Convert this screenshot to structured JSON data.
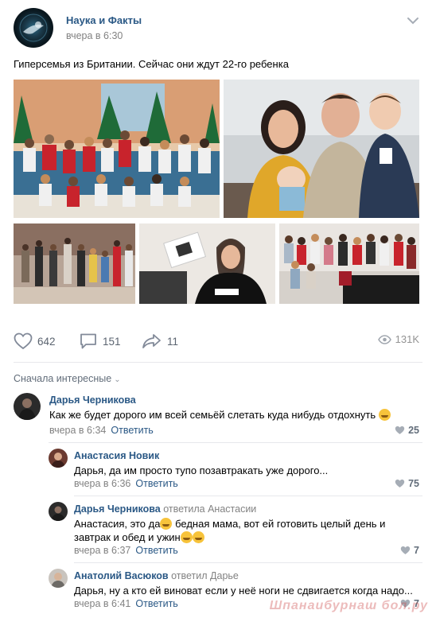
{
  "post": {
    "group_name": "Наука и Факты",
    "time": "вчера в 6:30",
    "text": "Гиперсемья из Британии. Сейчас они ждут 22-го ребенка"
  },
  "actions": {
    "likes": "642",
    "comments": "151",
    "shares": "11",
    "views": "131K"
  },
  "comments": {
    "sort_label": "Сначала интересные",
    "items": [
      {
        "author": "Дарья Черникова",
        "text": "Как же будет дорого им всей семьёй слетать куда нибудь отдохнуть",
        "time": "вчера в 6:34",
        "reply_label": "Ответить",
        "likes": "25"
      },
      {
        "author": "Анастасия Новик",
        "text": "Дарья, да им просто тупо позавтракать уже дорого...",
        "time": "вчера в 6:36",
        "reply_label": "Ответить",
        "likes": "75"
      },
      {
        "author": "Дарья Черникова",
        "reply_to": "ответила Анастасии",
        "text_line1": "Анастасия, это да",
        "text_line1b": " бедная мама, вот ей готовить целый день и",
        "text_line2": "завтрак и обед и ужин",
        "time": "вчера в 6:37",
        "reply_label": "Ответить",
        "likes": "7"
      },
      {
        "author": "Анатолий Васюков",
        "reply_to": "ответил Дарье",
        "text": "Дарья, ну а кто ей виноват если у неё ноги не сдвигается когда надо...",
        "time": "вчера в 6:41",
        "reply_label": "Ответить",
        "likes": "7"
      }
    ]
  },
  "watermark": "Шпанаибурнаш бол.ру",
  "colors": {
    "link": "#2a5885",
    "muted": "#828282",
    "divider": "#e7e8ec"
  }
}
